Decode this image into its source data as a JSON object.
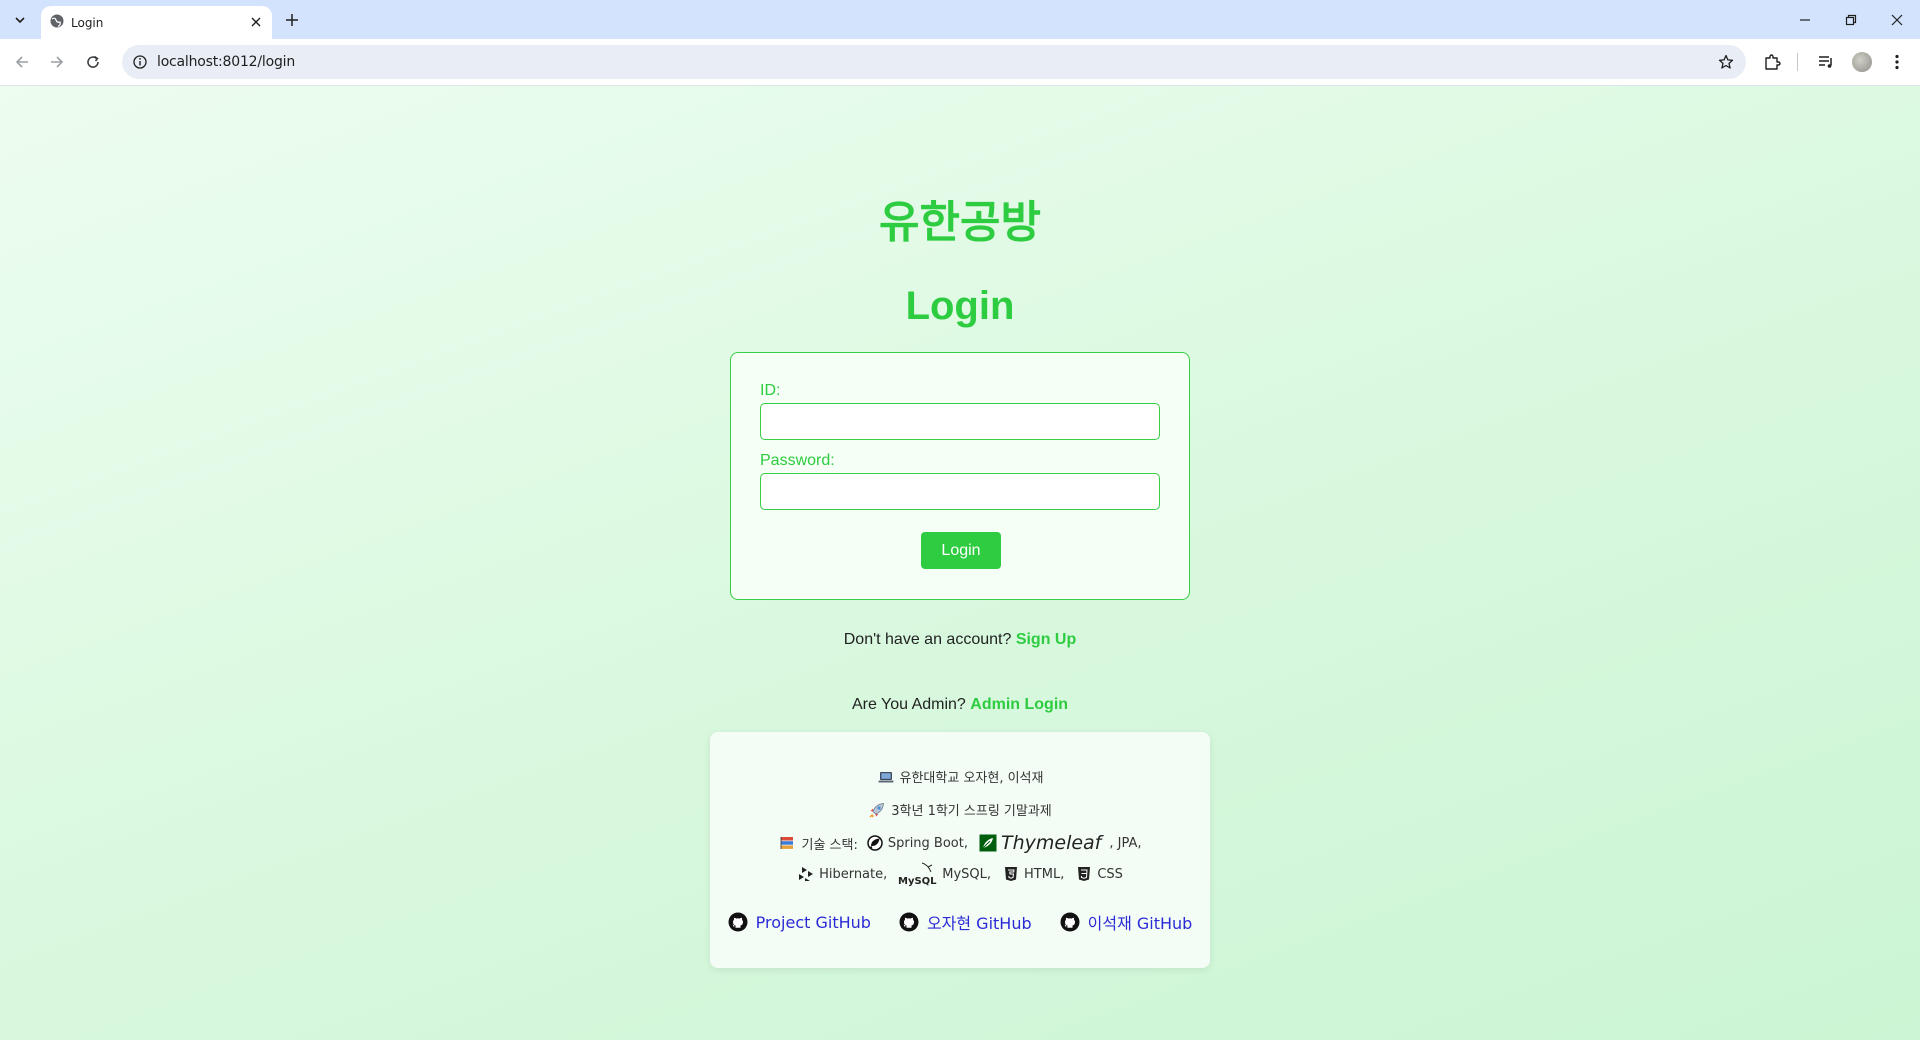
{
  "browser": {
    "tab_title": "Login",
    "url": "localhost:8012/login"
  },
  "page": {
    "brand": "유한공방",
    "title": "Login",
    "form": {
      "id_label": "ID:",
      "id_value": "",
      "password_label": "Password:",
      "password_value": "",
      "submit_label": "Login"
    },
    "signup_prompt": "Don't have an account?",
    "signup_link": "Sign Up",
    "admin_prompt": "Are You Admin?",
    "admin_link": "Admin Login"
  },
  "footer": {
    "line1_icon": "laptop-icon",
    "line1": "유한대학교 오자현, 이석재",
    "line2_icon": "rocket-icon",
    "line2": "3학년 1학기 스프링 기말과제",
    "stack_icon": "books-icon",
    "stack_label": "기술 스택:",
    "stack": {
      "spring": "Spring Boot,",
      "thymeleaf": "Thymeleaf",
      "jpa": ", JPA,",
      "hibernate": "Hibernate,",
      "mysql_logo_text": "MySQL",
      "mysql": "MySQL,",
      "html": "HTML,",
      "css": "CSS"
    },
    "links": {
      "project": "Project GitHub",
      "ojahyun": "오자현 GitHub",
      "leeseokjae": "이석재 GitHub"
    }
  },
  "colors": {
    "accent": "#2ecc40",
    "link": "#2b2bd6"
  }
}
